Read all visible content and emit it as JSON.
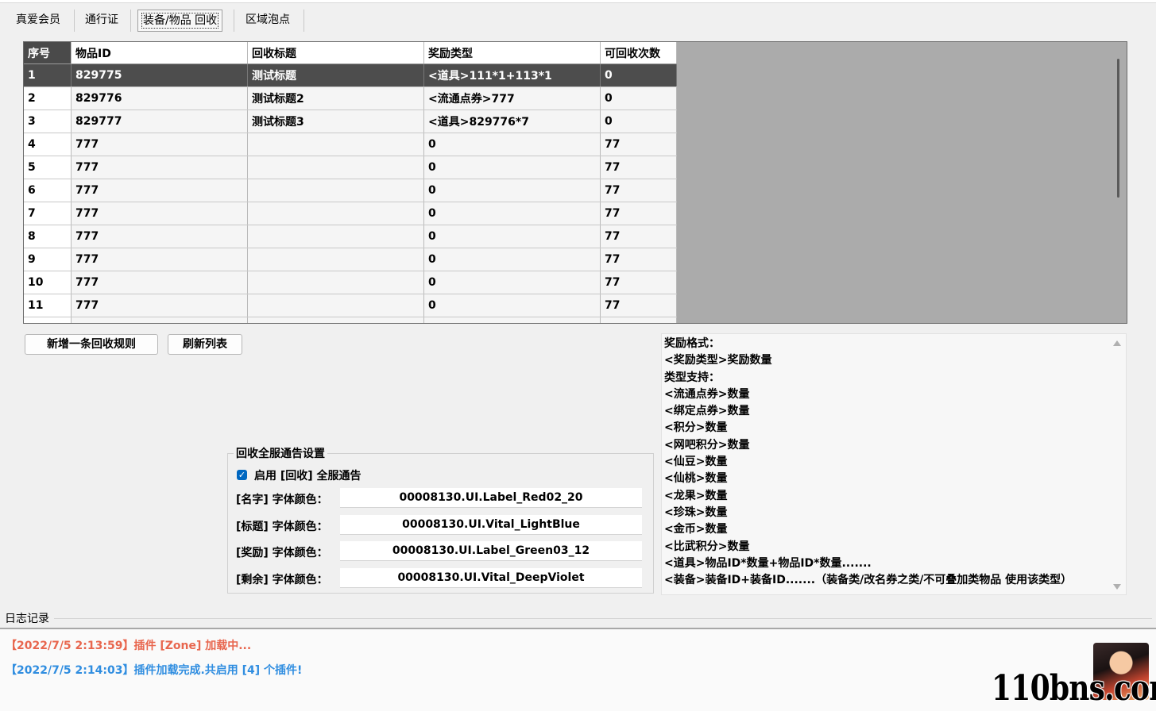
{
  "tabs": [
    {
      "label": "真爱会员"
    },
    {
      "label": "通行证"
    },
    {
      "label": "装备/物品 回收"
    },
    {
      "label": "区域泡点"
    }
  ],
  "active_tab": 2,
  "grid": {
    "columns": [
      "序号",
      "物品ID",
      "回收标题",
      "奖励类型",
      "可回收次数"
    ],
    "rows": [
      [
        "1",
        "829775",
        "测试标题",
        "<道具>111*1+113*1",
        "0"
      ],
      [
        "2",
        "829776",
        "测试标题2",
        "<流通点券>777",
        "0"
      ],
      [
        "3",
        "829777",
        "测试标题3",
        "<道具>829776*7",
        "0"
      ],
      [
        "4",
        "777",
        "",
        "0",
        "77"
      ],
      [
        "5",
        "777",
        "",
        "0",
        "77"
      ],
      [
        "6",
        "777",
        "",
        "0",
        "77"
      ],
      [
        "7",
        "777",
        "",
        "0",
        "77"
      ],
      [
        "8",
        "777",
        "",
        "0",
        "77"
      ],
      [
        "9",
        "777",
        "",
        "0",
        "77"
      ],
      [
        "10",
        "777",
        "",
        "0",
        "77"
      ],
      [
        "11",
        "777",
        "",
        "0",
        "77"
      ],
      [
        "",
        "",
        "",
        "",
        ""
      ]
    ],
    "selected_row": 0
  },
  "buttons": {
    "add_rule": "新增一条回收规则",
    "refresh": "刷新列表"
  },
  "announce": {
    "group_title": "回收全服通告设置",
    "enable_label": "启用 [回收] 全服通告",
    "enabled": true,
    "fields": [
      {
        "label": "[名字] 字体颜色：",
        "value": "00008130.UI.Label_Red02_20"
      },
      {
        "label": "[标题] 字体颜色：",
        "value": "00008130.UI.Vital_LightBlue"
      },
      {
        "label": "[奖励] 字体颜色：",
        "value": "00008130.UI.Label_Green03_12"
      },
      {
        "label": "[剩余] 字体颜色：",
        "value": "00008130.UI.Vital_DeepViolet"
      }
    ]
  },
  "reward_help": [
    "奖励格式：",
    "<奖励类型>奖励数量",
    "类型支持：",
    "<流通点券>数量",
    "<绑定点券>数量",
    "<积分>数量",
    "<网吧积分>数量",
    "<仙豆>数量",
    "<仙桃>数量",
    "<龙果>数量",
    "<珍珠>数量",
    "<金币>数量",
    "<比武积分>数量",
    "<道具>物品ID*数量+物品ID*数量.......",
    "<装备>装备ID+装备ID.......（装备类/改名券之类/不可叠加类物品 使用该类型）"
  ],
  "log": {
    "title": "日志记录",
    "entries": [
      {
        "text": "【2022/7/5 2:13:59】插件 [Zone] 加载中...",
        "color": "#e8664e"
      },
      {
        "text": "【2022/7/5 2:14:03】插件加载完成.共启用 [4] 个插件!",
        "color": "#2f8de0"
      }
    ]
  },
  "watermark": "110bns.com"
}
